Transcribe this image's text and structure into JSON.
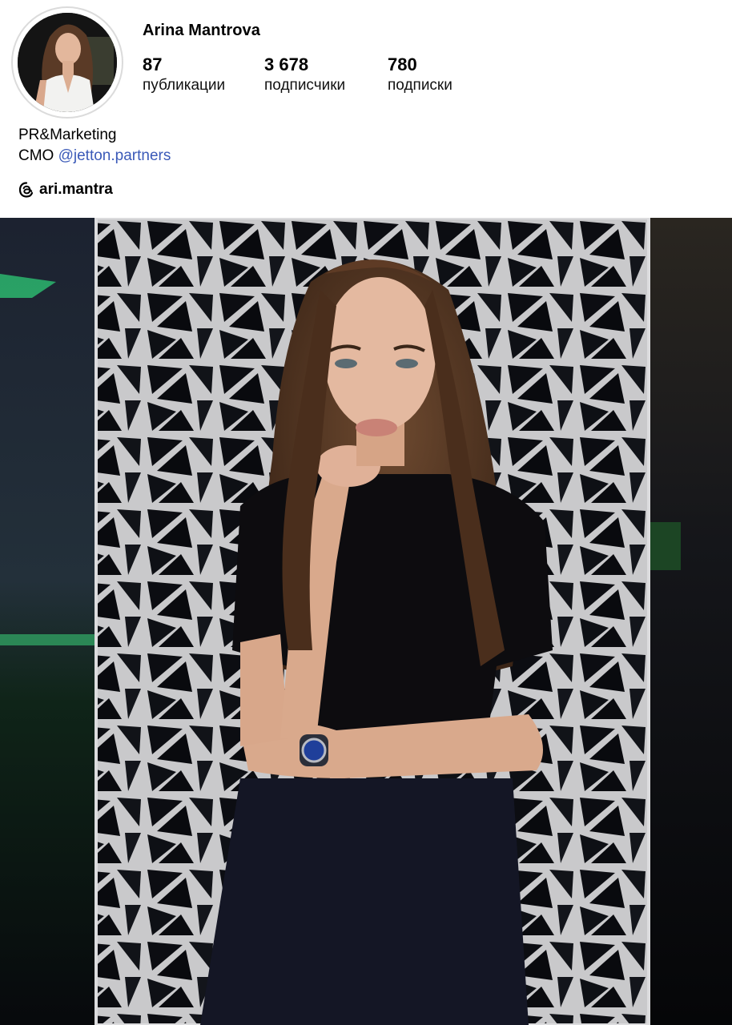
{
  "profile": {
    "username": "Arina Mantrova",
    "stats": [
      {
        "value": "87",
        "label": "публикации"
      },
      {
        "value": "3 678",
        "label": "подписчики"
      },
      {
        "value": "780",
        "label": "подписки"
      }
    ],
    "bio_line1": "PR&Marketing",
    "bio_line2_prefix": "CMO",
    "bio_line2_link": "@jetton.partners",
    "threads_handle": "ari.mantra"
  },
  "icons": {
    "threads": "threads-icon",
    "avatar": "profile-avatar"
  },
  "colors": {
    "link": "#3b5ab8",
    "ring": "#dbdbdb"
  }
}
